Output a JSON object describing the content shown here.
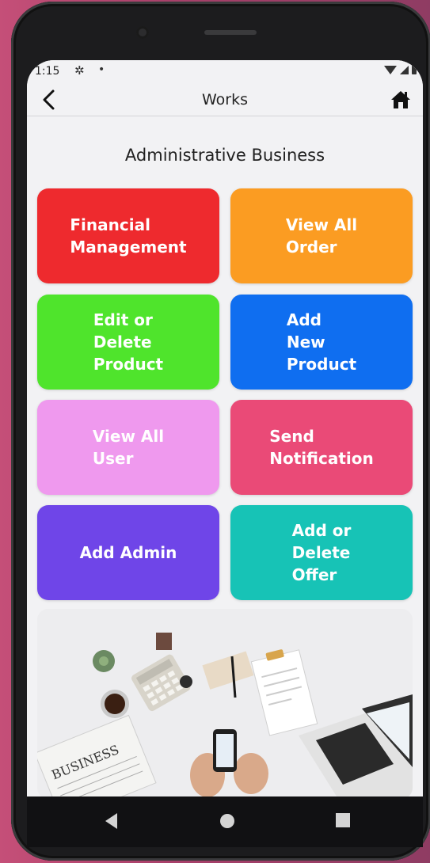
{
  "status_bar": {
    "time": "1:15",
    "settings_glyph": "✲",
    "dot": "•"
  },
  "app_bar": {
    "title": "Works",
    "back_icon": "chevron-left-icon",
    "home_icon": "home-icon"
  },
  "section_title": "Administrative Business",
  "tiles": [
    {
      "label": "Financial\nManagement",
      "color": "#ee2a2e"
    },
    {
      "label": "View All\nOrder",
      "color": "#fb9c22"
    },
    {
      "label": "Edit or\nDelete\nProduct",
      "color": "#4fe42c"
    },
    {
      "label": "Add\nNew\nProduct",
      "color": "#0f6ef0"
    },
    {
      "label": "View All\nUser",
      "color": "#ef99ee"
    },
    {
      "label": "Send\nNotification",
      "color": "#ea4a77"
    },
    {
      "label": "Add Admin",
      "color": "#6f45e8"
    },
    {
      "label": "Add or\nDelete\nOffer",
      "color": "#17c3b6"
    }
  ],
  "illustration": {
    "newspaper_text": "BUSINESS"
  },
  "nav": {
    "back": "nav-back-icon",
    "home": "nav-home-icon",
    "recents": "nav-recents-icon"
  }
}
